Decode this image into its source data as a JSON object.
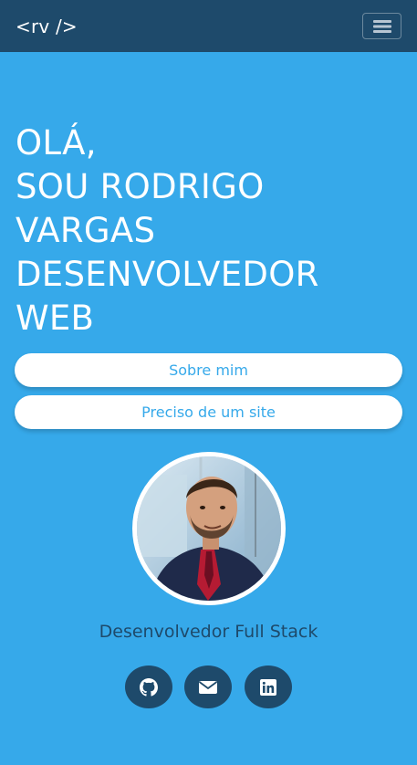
{
  "navbar": {
    "brand": "<rv />",
    "toggler_icon": "hamburger-menu-icon"
  },
  "hero": {
    "lines": [
      "OLÁ,",
      "SOU RODRIGO",
      "VARGAS",
      "DESENVOLVEDOR",
      "WEB"
    ]
  },
  "buttons": {
    "about": "Sobre mim",
    "need_site": "Preciso de um site"
  },
  "profile": {
    "subtitle": "Desenvolvedor Full Stack"
  },
  "social": [
    {
      "icon": "github-icon"
    },
    {
      "icon": "envelope-icon"
    },
    {
      "icon": "linkedin-icon"
    }
  ],
  "colors": {
    "background": "#36a9ea",
    "navbar": "#1e4a6b",
    "button_bg": "#ffffff",
    "button_text": "#36a9ea",
    "accent_dark": "#1e4a6b"
  }
}
